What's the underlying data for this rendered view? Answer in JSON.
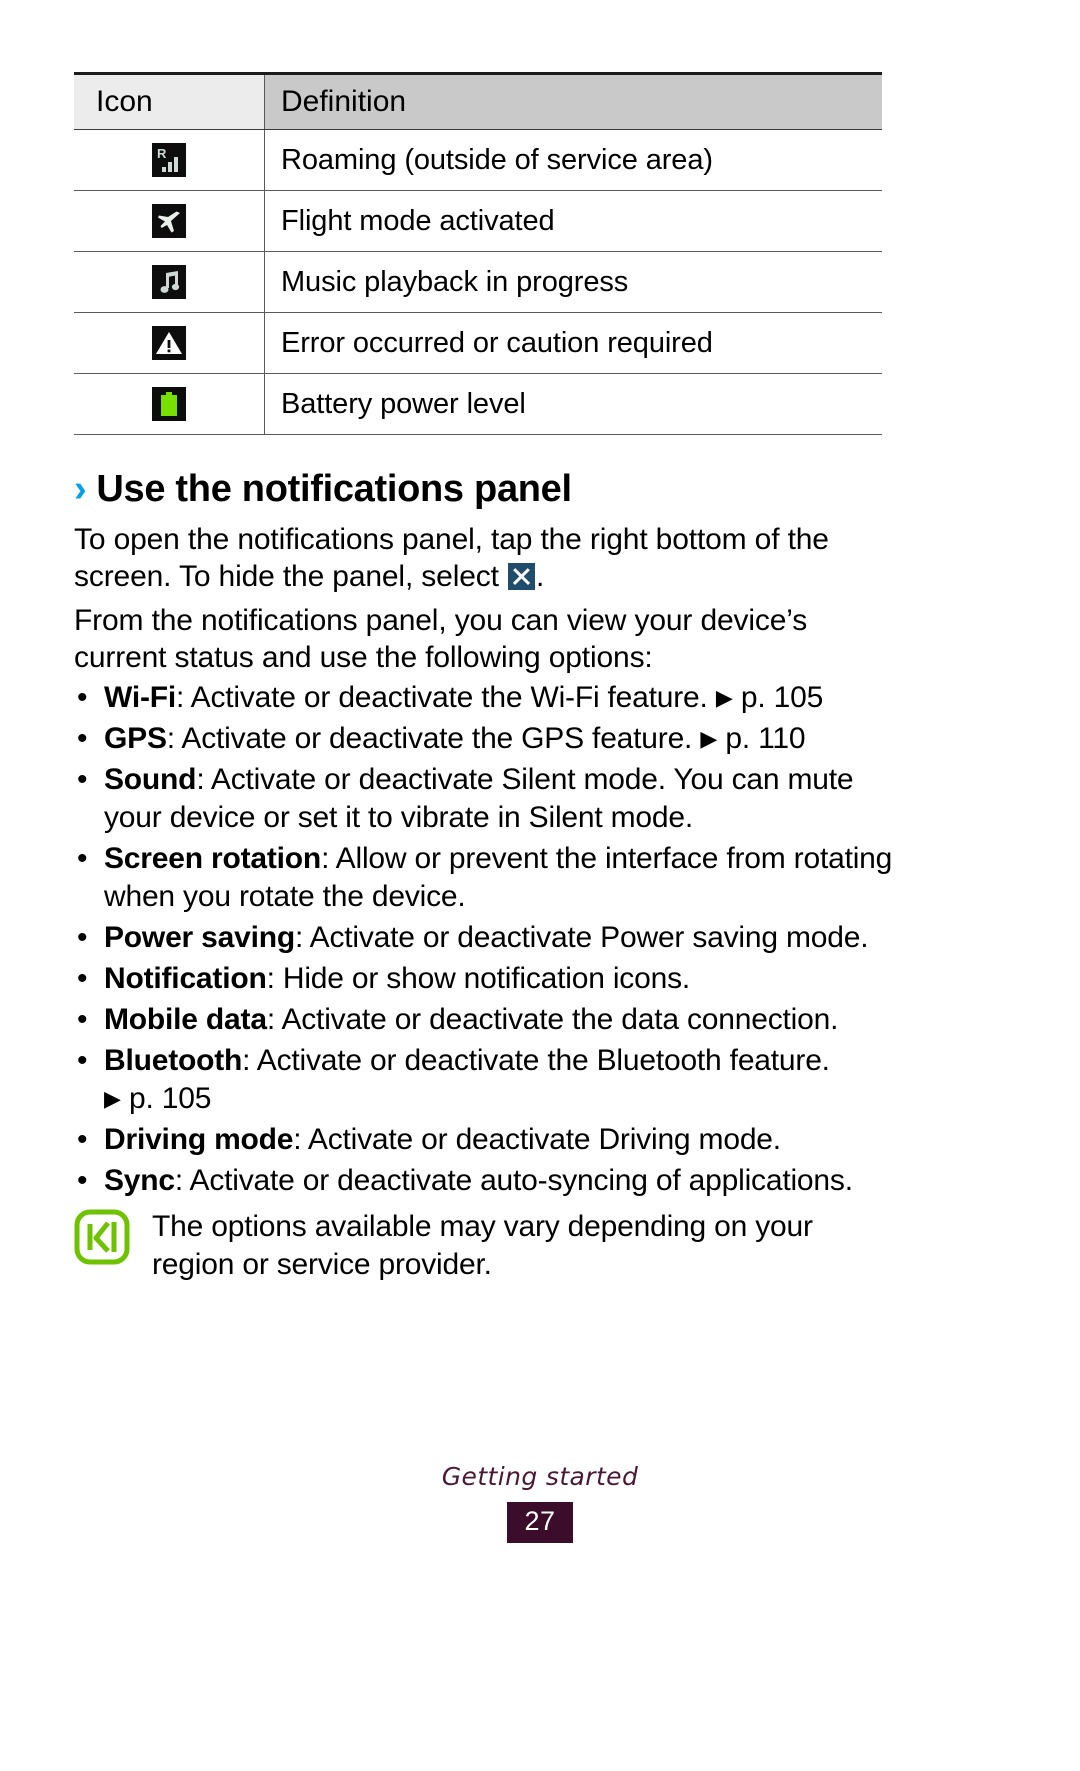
{
  "table": {
    "headers": [
      "Icon",
      "Definition"
    ],
    "rows": [
      {
        "icon": "roaming-signal-icon",
        "definition": "Roaming (outside of service area)"
      },
      {
        "icon": "flight-mode-icon",
        "definition": "Flight mode activated"
      },
      {
        "icon": "music-note-icon",
        "definition": "Music playback in progress"
      },
      {
        "icon": "warning-triangle-icon",
        "definition": "Error occurred or caution required"
      },
      {
        "icon": "battery-icon",
        "definition": "Battery power level"
      }
    ]
  },
  "heading": {
    "chevron": "›",
    "text": "Use the notifications panel"
  },
  "paragraphs": {
    "p1_a": "To open the notifications panel, tap the right bottom of the screen. To hide the panel, select ",
    "p1_b": ".",
    "p2": "From the notifications panel, you can view your device’s current status and use the following options:"
  },
  "bullets": [
    {
      "dot": "•",
      "label": "Wi-Fi",
      "text": ": Activate or deactivate the Wi-Fi feature. ",
      "arrow": "▶",
      "ref": " p. 105"
    },
    {
      "dot": "•",
      "label": "GPS",
      "text": ": Activate or deactivate the GPS feature. ",
      "arrow": "▶",
      "ref": " p. 110"
    },
    {
      "dot": "•",
      "label": "Sound",
      "text": ": Activate or deactivate Silent mode. You can mute your device or set it to vibrate in Silent mode.",
      "arrow": "",
      "ref": ""
    },
    {
      "dot": "•",
      "label": "Screen rotation",
      "text": ": Allow or prevent the interface from rotating when you rotate the device.",
      "arrow": "",
      "ref": ""
    },
    {
      "dot": "•",
      "label": "Power saving",
      "text": ": Activate or deactivate Power saving mode.",
      "arrow": "",
      "ref": ""
    },
    {
      "dot": "•",
      "label": "Notification",
      "text": ": Hide or show notification icons.",
      "arrow": "",
      "ref": ""
    },
    {
      "dot": "•",
      "label": "Mobile data",
      "text": ": Activate or deactivate the data connection.",
      "arrow": "",
      "ref": ""
    },
    {
      "dot": "•",
      "label": "Bluetooth",
      "text": ": Activate or deactivate the Bluetooth feature.",
      "arrow": "▶",
      "ref": " p. 105"
    },
    {
      "dot": "•",
      "label": "Driving mode",
      "text": ": Activate or deactivate Driving mode.",
      "arrow": "",
      "ref": ""
    },
    {
      "dot": "•",
      "label": "Sync",
      "text": ": Activate or deactivate auto-syncing of applications.",
      "arrow": "",
      "ref": ""
    }
  ],
  "note": {
    "icon": "note-pen-icon",
    "text": "The options available may vary depending on your region or service provider."
  },
  "footer": {
    "title": "Getting started",
    "page_number": "27"
  },
  "colors": {
    "accent_chevron": "#00a2e8",
    "note_green": "#6ec200",
    "battery_green": "#78e000",
    "footer_purple": "#4b1736",
    "badge_purple": "#3b0d2b",
    "close_icon_blue": "#1f4d6b"
  }
}
